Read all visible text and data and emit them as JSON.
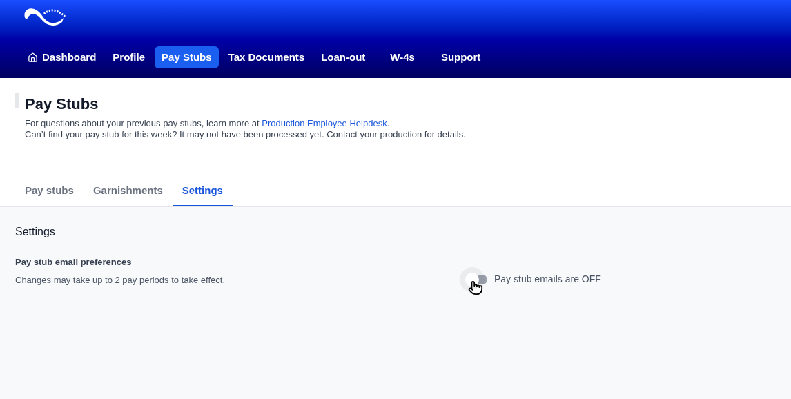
{
  "nav": {
    "items": [
      {
        "label": "Dashboard",
        "kind": "home",
        "selected": false
      },
      {
        "label": "Profile",
        "kind": "plain",
        "selected": false
      },
      {
        "label": "Pay Stubs",
        "kind": "plain",
        "selected": true
      },
      {
        "label": "Tax Documents",
        "kind": "plain",
        "selected": false
      },
      {
        "label": "Loan-out",
        "kind": "plain",
        "selected": false
      },
      {
        "label": "W-4s",
        "kind": "plain",
        "selected": false
      },
      {
        "label": "Support",
        "kind": "plain",
        "selected": false
      }
    ]
  },
  "page": {
    "title": "Pay Stubs",
    "intro": "For questions about your previous pay stubs, learn more at",
    "link": "Production Employee Helpdesk.",
    "note": "Can’t find your pay stub for this week? It may not have been processed yet. Contact your production for details."
  },
  "tabs": [
    {
      "label": "Pay stubs",
      "selected": false
    },
    {
      "label": "Garnishments",
      "selected": false
    },
    {
      "label": "Settings",
      "selected": true
    }
  ],
  "settings": {
    "heading": "Settings",
    "label": "Pay stub email preferences",
    "description": "Changes may take up to 2 pay periods to take effect.",
    "toggle": {
      "on": false,
      "label": "Pay stub emails are OFF"
    }
  }
}
